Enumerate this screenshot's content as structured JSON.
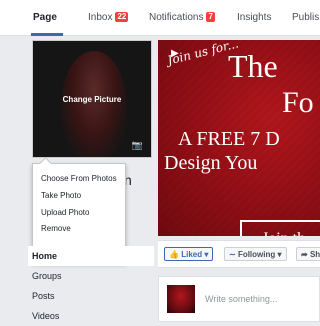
{
  "tabs": [
    {
      "label": "Page",
      "active": true
    },
    {
      "label": "Inbox",
      "badge": "22"
    },
    {
      "label": "Notifications",
      "badge": "7"
    },
    {
      "label": "Insights"
    },
    {
      "label": "Publis"
    }
  ],
  "profile": {
    "change_picture_label": "Change Picture",
    "name_fragment": "n",
    "menu_items": [
      "Choose From Photos",
      "Take Photo",
      "Upload Photo",
      "Remove"
    ]
  },
  "sidebar_nav": [
    "Home",
    "Groups",
    "Posts",
    "Videos"
  ],
  "cover": {
    "script_text": "Join us for...",
    "line1": "The",
    "line2": "Fo",
    "line3": "A FREE 7 D",
    "line4": "Design You",
    "button": "Join th"
  },
  "actions": {
    "liked": "Liked",
    "following": "Following",
    "share": "Sh"
  },
  "composer": {
    "placeholder": "Write something..."
  },
  "colors": {
    "accent": "#4267b2",
    "badge": "#fa3e3e",
    "cover_red": "#a3121a"
  }
}
